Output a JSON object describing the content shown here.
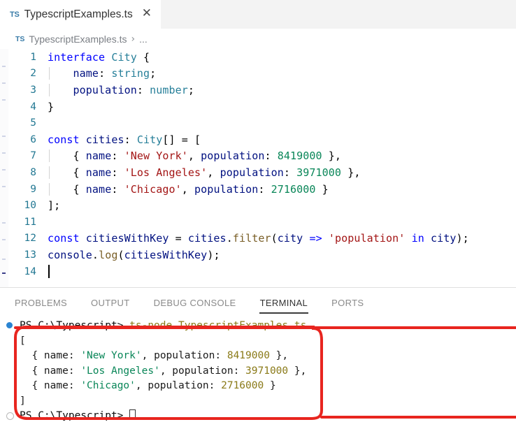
{
  "window": {
    "app": "vscode-editor"
  },
  "tabbar": {
    "tabs": [
      {
        "badge": "TS",
        "label": "TypescriptExamples.ts",
        "close": "✕",
        "active": true
      }
    ]
  },
  "breadcrumb": {
    "badge": "TS",
    "file": "TypescriptExamples.ts",
    "separator": "›",
    "more": "..."
  },
  "editor": {
    "language": "typescript",
    "cursor_line": 14,
    "lines": [
      {
        "n": "1",
        "tokens": [
          {
            "t": "interface",
            "c": "t-kw"
          },
          {
            "t": " ",
            "c": "t-plain"
          },
          {
            "t": "City",
            "c": "t-type"
          },
          {
            "t": " ",
            "c": "t-plain"
          },
          {
            "t": "{",
            "c": "t-punct"
          }
        ]
      },
      {
        "n": "2",
        "indent": 1,
        "tokens": [
          {
            "t": "    ",
            "c": "t-plain"
          },
          {
            "t": "name",
            "c": "t-prop"
          },
          {
            "t": ": ",
            "c": "t-punct"
          },
          {
            "t": "string",
            "c": "t-type"
          },
          {
            "t": ";",
            "c": "t-punct"
          }
        ]
      },
      {
        "n": "3",
        "indent": 1,
        "tokens": [
          {
            "t": "    ",
            "c": "t-plain"
          },
          {
            "t": "population",
            "c": "t-prop"
          },
          {
            "t": ": ",
            "c": "t-punct"
          },
          {
            "t": "number",
            "c": "t-type"
          },
          {
            "t": ";",
            "c": "t-punct"
          }
        ]
      },
      {
        "n": "4",
        "tokens": [
          {
            "t": "}",
            "c": "t-punct"
          }
        ]
      },
      {
        "n": "5",
        "tokens": []
      },
      {
        "n": "6",
        "tokens": [
          {
            "t": "const",
            "c": "t-kw"
          },
          {
            "t": " ",
            "c": "t-plain"
          },
          {
            "t": "cities",
            "c": "t-var"
          },
          {
            "t": ": ",
            "c": "t-punct"
          },
          {
            "t": "City",
            "c": "t-type"
          },
          {
            "t": "[] = [",
            "c": "t-punct"
          }
        ]
      },
      {
        "n": "7",
        "indent": 1,
        "tokens": [
          {
            "t": "    { ",
            "c": "t-punct"
          },
          {
            "t": "name",
            "c": "t-prop"
          },
          {
            "t": ": ",
            "c": "t-punct"
          },
          {
            "t": "'New York'",
            "c": "t-str"
          },
          {
            "t": ", ",
            "c": "t-punct"
          },
          {
            "t": "population",
            "c": "t-prop"
          },
          {
            "t": ": ",
            "c": "t-punct"
          },
          {
            "t": "8419000",
            "c": "t-num"
          },
          {
            "t": " },",
            "c": "t-punct"
          }
        ]
      },
      {
        "n": "8",
        "indent": 1,
        "tokens": [
          {
            "t": "    { ",
            "c": "t-punct"
          },
          {
            "t": "name",
            "c": "t-prop"
          },
          {
            "t": ": ",
            "c": "t-punct"
          },
          {
            "t": "'Los Angeles'",
            "c": "t-str"
          },
          {
            "t": ", ",
            "c": "t-punct"
          },
          {
            "t": "population",
            "c": "t-prop"
          },
          {
            "t": ": ",
            "c": "t-punct"
          },
          {
            "t": "3971000",
            "c": "t-num"
          },
          {
            "t": " },",
            "c": "t-punct"
          }
        ]
      },
      {
        "n": "9",
        "indent": 1,
        "tokens": [
          {
            "t": "    { ",
            "c": "t-punct"
          },
          {
            "t": "name",
            "c": "t-prop"
          },
          {
            "t": ": ",
            "c": "t-punct"
          },
          {
            "t": "'Chicago'",
            "c": "t-str"
          },
          {
            "t": ", ",
            "c": "t-punct"
          },
          {
            "t": "population",
            "c": "t-prop"
          },
          {
            "t": ": ",
            "c": "t-punct"
          },
          {
            "t": "2716000",
            "c": "t-num"
          },
          {
            "t": " }",
            "c": "t-punct"
          }
        ]
      },
      {
        "n": "10",
        "tokens": [
          {
            "t": "];",
            "c": "t-punct"
          }
        ]
      },
      {
        "n": "11",
        "tokens": []
      },
      {
        "n": "12",
        "tokens": [
          {
            "t": "const",
            "c": "t-kw"
          },
          {
            "t": " ",
            "c": "t-plain"
          },
          {
            "t": "citiesWithKey",
            "c": "t-var"
          },
          {
            "t": " = ",
            "c": "t-punct"
          },
          {
            "t": "cities",
            "c": "t-var"
          },
          {
            "t": ".",
            "c": "t-punct"
          },
          {
            "t": "filter",
            "c": "t-fn"
          },
          {
            "t": "(",
            "c": "t-punct"
          },
          {
            "t": "city",
            "c": "t-var"
          },
          {
            "t": " ",
            "c": "t-plain"
          },
          {
            "t": "=>",
            "c": "t-kw"
          },
          {
            "t": " ",
            "c": "t-plain"
          },
          {
            "t": "'population'",
            "c": "t-str"
          },
          {
            "t": " ",
            "c": "t-plain"
          },
          {
            "t": "in",
            "c": "t-kw"
          },
          {
            "t": " ",
            "c": "t-plain"
          },
          {
            "t": "city",
            "c": "t-var"
          },
          {
            "t": ");",
            "c": "t-punct"
          }
        ]
      },
      {
        "n": "13",
        "tokens": [
          {
            "t": "console",
            "c": "t-var"
          },
          {
            "t": ".",
            "c": "t-punct"
          },
          {
            "t": "log",
            "c": "t-fn"
          },
          {
            "t": "(",
            "c": "t-punct"
          },
          {
            "t": "citiesWithKey",
            "c": "t-var"
          },
          {
            "t": ");",
            "c": "t-punct"
          }
        ]
      },
      {
        "n": "14",
        "tokens": [],
        "caret": true
      }
    ]
  },
  "panel": {
    "tabs": [
      {
        "label": "PROBLEMS",
        "active": false
      },
      {
        "label": "OUTPUT",
        "active": false
      },
      {
        "label": "DEBUG CONSOLE",
        "active": false
      },
      {
        "label": "TERMINAL",
        "active": true
      },
      {
        "label": "PORTS",
        "active": false
      }
    ],
    "terminal": {
      "lines": [
        {
          "deco": "blue",
          "segments": [
            {
              "t": "PS C:\\Typescript> ",
              "c": "tm-prompt"
            },
            {
              "t": "ts-node TypescriptExamples.ts",
              "c": "tm-cmd"
            }
          ]
        },
        {
          "segments": [
            {
              "t": "[",
              "c": "tm-plain"
            }
          ]
        },
        {
          "segments": [
            {
              "t": "  { name: ",
              "c": "tm-plain"
            },
            {
              "t": "'New York'",
              "c": "tm-green"
            },
            {
              "t": ", population: ",
              "c": "tm-plain"
            },
            {
              "t": "8419000",
              "c": "tm-num"
            },
            {
              "t": " },",
              "c": "tm-plain"
            }
          ]
        },
        {
          "segments": [
            {
              "t": "  { name: ",
              "c": "tm-plain"
            },
            {
              "t": "'Los Angeles'",
              "c": "tm-green"
            },
            {
              "t": ", population: ",
              "c": "tm-plain"
            },
            {
              "t": "3971000",
              "c": "tm-num"
            },
            {
              "t": " },",
              "c": "tm-plain"
            }
          ]
        },
        {
          "segments": [
            {
              "t": "  { name: ",
              "c": "tm-plain"
            },
            {
              "t": "'Chicago'",
              "c": "tm-green"
            },
            {
              "t": ", population: ",
              "c": "tm-plain"
            },
            {
              "t": "2716000",
              "c": "tm-num"
            },
            {
              "t": " }",
              "c": "tm-plain"
            }
          ]
        },
        {
          "segments": [
            {
              "t": "]",
              "c": "tm-plain"
            }
          ]
        },
        {
          "deco": "ring",
          "cursor": true,
          "segments": [
            {
              "t": "PS C:\\Typescript> ",
              "c": "tm-prompt"
            }
          ]
        }
      ]
    }
  },
  "annotation": {
    "shape": "rounded-rectangle-highlight",
    "color": "#e8251f",
    "stroke_width": 4
  }
}
